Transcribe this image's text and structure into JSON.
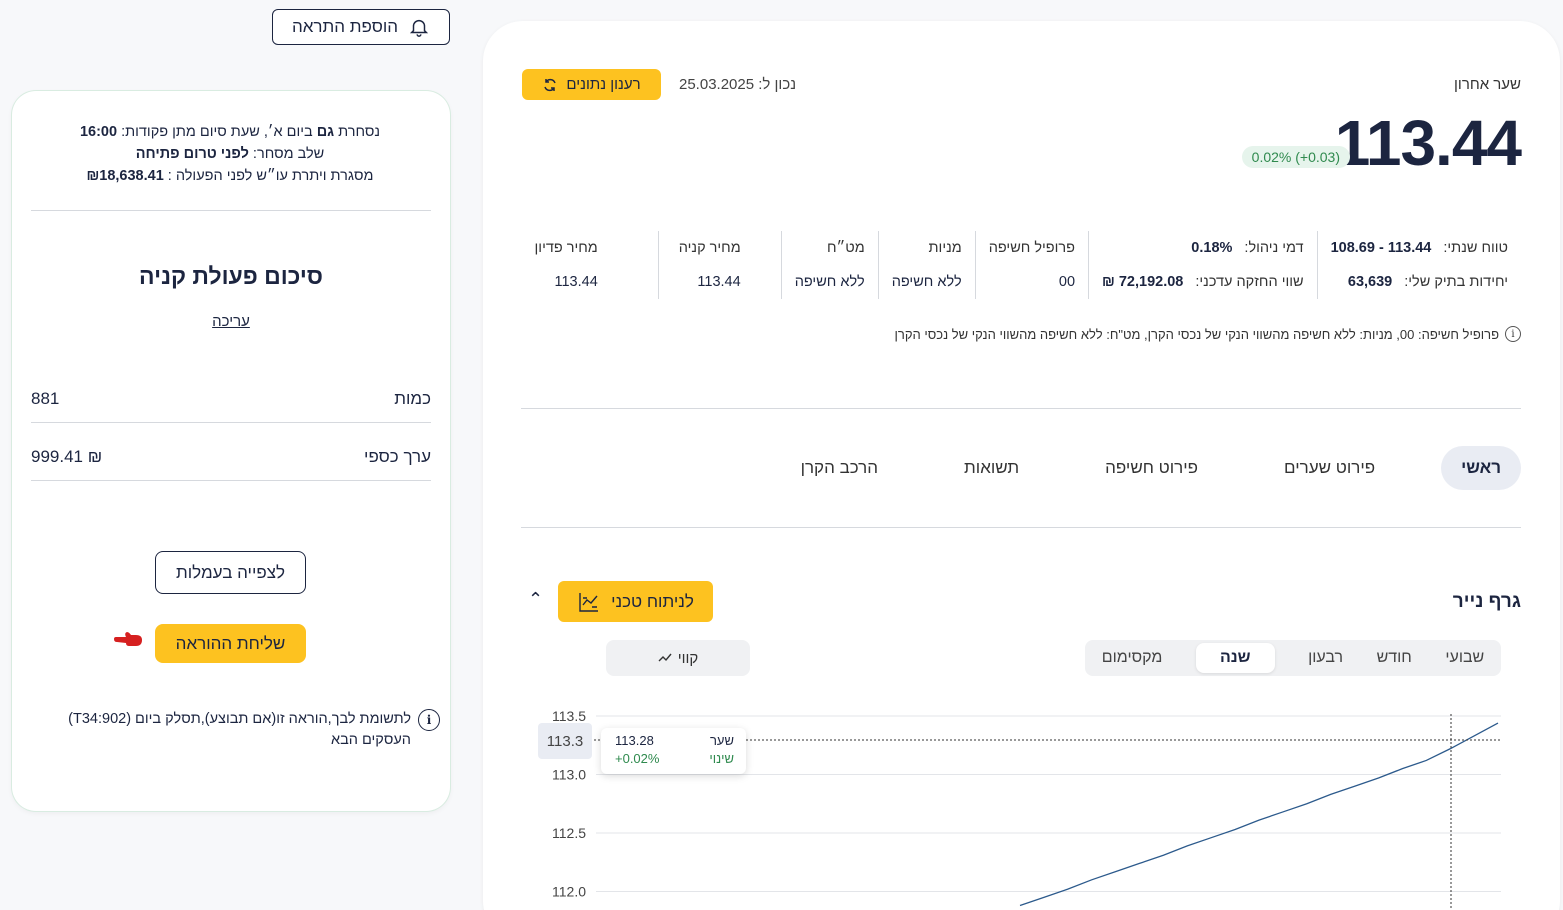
{
  "add_alert": {
    "label": "הוספת התראה"
  },
  "order": {
    "info_line1_prefix": "נסחרת",
    "info_line1_days": "גם",
    "info_line1_mid": "ביום א׳, שעת סיום מתן פקודות:",
    "info_line1_time": "16:00",
    "info_line2_prefix": "שלב מסחר:",
    "info_line2_value": "לפני טרום פתיחה",
    "info_line3_prefix": "מסגרת ויתרת עו״ש לפני הפעולה :",
    "info_line3_value": "₪18,638.41",
    "summary_title": "סיכום פעולת קניה",
    "edit_label": "עריכה",
    "quantity_label": "כמות",
    "quantity_value": "881",
    "cash_label": "ערך כספי",
    "cash_value": "999.41 ₪",
    "view_fees_label": "לצפייה בעמלות",
    "send_order_label": "שליחת ההוראה",
    "note_icon": "i",
    "note_text": "לתשומת לבך,הוראה זו(אם תבוצע),תסלק ביום (T34:902) העסקים הבא"
  },
  "quote": {
    "last_label": "שער אחרון",
    "price": "113.44",
    "change": "0.02% (+0.03)",
    "refresh_label": "רענון נתונים",
    "asof_label": "נכון ל: 25.03.2025"
  },
  "stats": {
    "range_label": "טווח שנתי:",
    "range_value": "108.69 - 113.44",
    "fee_label": "דמי ניהול:",
    "fee_value": "0.18%",
    "units_label": "יחידות בתיק שלי:",
    "units_value": "63,639",
    "holding_label": "שווי החזקה עדכני:",
    "holding_value": "₪ 72,192.08",
    "exposure_label": "פרופיל חשיפה",
    "exposure_value": "00",
    "stocks_label": "מניות",
    "stocks_value": "ללא חשיפה",
    "fx_label": "מט״ח",
    "fx_value": "ללא חשיפה",
    "buy_label": "מחיר קניה",
    "buy_value": "113.44",
    "redeem_label": "מחיר פדיון",
    "redeem_value": "113.44",
    "footnote_icon": "i",
    "footnote": "פרופיל חשיפה: 00, מניות: ללא חשיפה מהשווי הנקי של נכסי הקרן, מט\"ח: ללא חשיפה מהשווי הנקי של נכסי הקרן"
  },
  "tabs": [
    "ראשי",
    "פירוט שערים",
    "פירוט חשיפה",
    "תשואות",
    "הרכב הקרן"
  ],
  "graph": {
    "title": "גרף נייר",
    "ta_label": "לניתוח טכני",
    "chevron_icon": "chevron-up-icon",
    "chevron_glyph": "⌃",
    "periods": [
      "שבועי",
      "חודש",
      "רבעון",
      "שנה",
      "מקסימום"
    ],
    "line_label": "קווי",
    "hover_y_label": "113.3",
    "tooltip": {
      "price_label": "שער",
      "price_value": "113.28",
      "change_label": "שינוי",
      "change_value": "+0.02%"
    }
  },
  "chart_data": {
    "type": "line",
    "yticks": [
      "113.5",
      "113.0",
      "112.5",
      "112.0"
    ],
    "ylim": [
      111.9,
      113.5
    ],
    "x": [
      0,
      0.05,
      0.1,
      0.15,
      0.2,
      0.25,
      0.3,
      0.35,
      0.4,
      0.45,
      0.5,
      0.55,
      0.6,
      0.65,
      0.7,
      0.75,
      0.8,
      0.85,
      0.9,
      0.95,
      1.0
    ],
    "values": [
      111.88,
      111.95,
      112.02,
      112.1,
      112.17,
      112.24,
      112.31,
      112.39,
      112.46,
      112.53,
      112.61,
      112.68,
      112.75,
      112.83,
      112.9,
      112.97,
      113.05,
      113.12,
      113.22,
      113.33,
      113.44
    ],
    "colors": {
      "line": "#2c5a8c"
    }
  }
}
